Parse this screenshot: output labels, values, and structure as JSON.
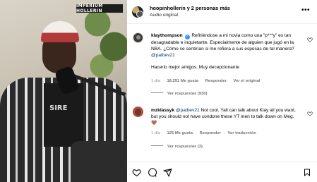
{
  "media": {
    "overlay_logo": "IMPERIUM HOLLERIN",
    "shirt_text": "SIRE"
  },
  "header": {
    "title": "hoopinhollerin y 2 personas más",
    "subtitle": "Audio original"
  },
  "comments": [
    {
      "username": "klaythompson",
      "verified": true,
      "text": "Refiriéndose a mi novia como una \"p***y\" es tan desagradable e inquietante. Especialmente de alguien que jugó en la NBA. ¿Cómo se sentirían si me refiera a sus esposas de tal manera?",
      "mention": "@patbev21",
      "text2": "Hacerlo mejor amigos. Muy decepcionante",
      "time": "1 día",
      "likes": "18.251 Me gusta",
      "reply": "Responder",
      "translate": "Ver el original",
      "view_replies": "Ver respuestas (930)"
    },
    {
      "username": "mzklassyk",
      "mention": "@patbev21",
      "text": "Not cool. Yall can talk about Klay all you want, but you should not have condone these YT men to talk down on Meg. 🤎",
      "time": "1 día",
      "likes": "125 Me gusta",
      "reply": "Responder",
      "translate": "Ver traducción",
      "view_replies": "Ver respuestas (3)"
    }
  ],
  "actions": {
    "icons": [
      "heart-icon",
      "comment-icon",
      "share-icon",
      "bookmark-icon"
    ]
  }
}
